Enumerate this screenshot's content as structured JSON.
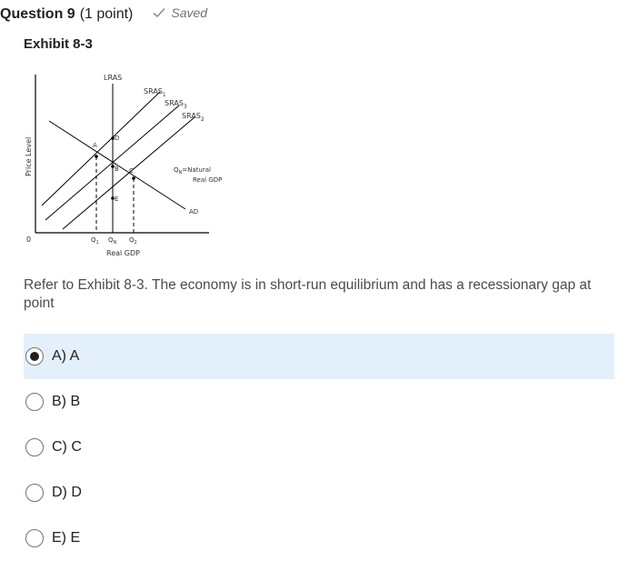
{
  "question": {
    "title": "Question 9",
    "points": "(1 point)",
    "status": "Saved",
    "status_icon": "checkmark-icon"
  },
  "exhibit": {
    "title": "Exhibit 8-3",
    "labels": {
      "lras": "LRAS",
      "sras1": "SRAS",
      "sras1_sub": "1",
      "sras3": "SRAS",
      "sras3_sub": "3",
      "sras2": "SRAS",
      "sras2_sub": "2",
      "price_level": "Price Level",
      "origin": "0",
      "point_a": "A",
      "point_b": "B",
      "point_c": "C",
      "point_d": "D",
      "point_e": "E",
      "q1": "Q",
      "q1_sub": "1",
      "qn": "Q",
      "qn_sub": "N",
      "q2": "Q",
      "q2_sub": "2",
      "real_gdp": "Real  GDP",
      "legend_line1": "Q",
      "legend_line1_sub": "N",
      "legend_line1_rest": "=Natural",
      "legend_line2": "Real GDP",
      "ad": "AD"
    }
  },
  "prompt": "Refer to Exhibit 8-3. The economy is in short-run equilibrium and has a recessionary gap at point",
  "options": [
    {
      "label": "A) A",
      "selected": true
    },
    {
      "label": "B) B",
      "selected": false
    },
    {
      "label": "C) C",
      "selected": false
    },
    {
      "label": "D) D",
      "selected": false
    },
    {
      "label": "E) E",
      "selected": false
    }
  ]
}
